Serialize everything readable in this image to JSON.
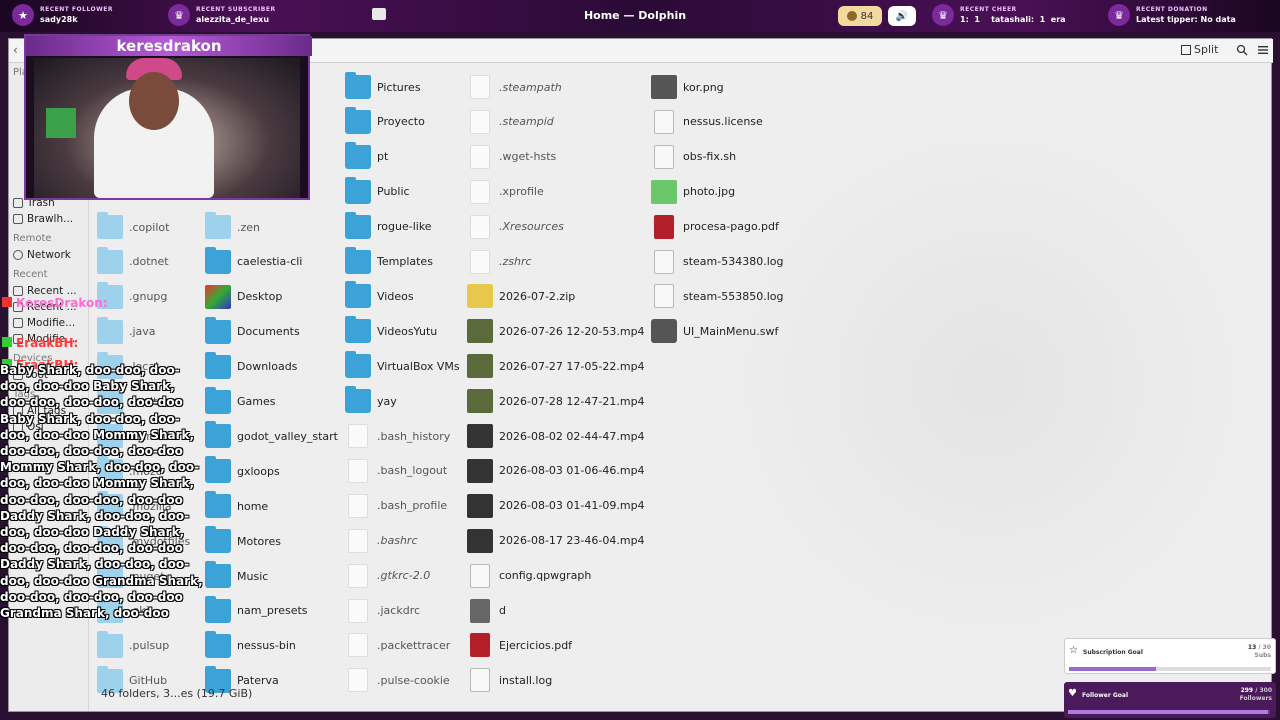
{
  "topbar": {
    "follower_label": "RECENT FOLLOWER",
    "follower_name": "sady28k",
    "subscriber_label": "RECENT SUBSCRIBER",
    "subscriber_name": "alezzita_de_lexu",
    "window_title": "Home — Dolphin",
    "points": "84",
    "cheer_label": "RECENT CHEER",
    "cheer_left": "1:",
    "cheer_one": "1",
    "cheer_name": "tatashali:",
    "cheer_two": "1",
    "cheer_extra": "era",
    "donation_label": "RECENT DONATION",
    "donation_text": "Latest tipper: No data"
  },
  "toolbar": {
    "split_label": "Split"
  },
  "sidebar": {
    "top_label": "Plac",
    "trash": "Trash",
    "brawl": "Brawlh...",
    "remote_section": "Remote",
    "network": "Network",
    "recent_section": "Recent",
    "recent_files": "Recent ...",
    "recent_locations": "Recent ...",
    "modified1": "Modifie...",
    "modified2": "Modifie...",
    "devices_section": "Devices",
    "root": "root",
    "tags_section": "Tags",
    "all_tags": "All tags",
    "osi": "Osi"
  },
  "columns": [
    [
      {
        "name": ".copilot",
        "type": "hfolder",
        "style": "hidden"
      },
      {
        "name": ".dotnet",
        "type": "hfolder",
        "style": "hidden"
      },
      {
        "name": ".gnupg",
        "type": "hfolder",
        "style": "hidden"
      },
      {
        "name": ".java",
        "type": "hfolder",
        "style": "hidden"
      },
      {
        "name": ".local",
        "type": "hfolder",
        "style": "hidden"
      },
      {
        "name": ".maltego",
        "type": "hfolder",
        "style": "hidden"
      },
      {
        "name": ".minecraft",
        "type": "hfolder",
        "style": "hidden"
      },
      {
        "name": ".mozc",
        "type": "hfolder",
        "style": "hidden"
      },
      {
        "name": ".mozilla",
        "type": "hfolder",
        "style": "hidden"
      },
      {
        "name": ".mydotfiles",
        "type": "hfolder",
        "style": "hidden"
      },
      {
        "name": ".nuget",
        "type": "hfolder",
        "style": "hidden"
      },
      {
        "name": ".oki",
        "type": "hfolder",
        "style": "hidden"
      },
      {
        "name": ".pulsup",
        "type": "hfolder",
        "style": "hidden"
      },
      {
        "name": "GitHub",
        "type": "hfolder",
        "style": "hidden"
      }
    ],
    [
      {
        "name": ".zen",
        "type": "hfolder",
        "style": "hidden"
      },
      {
        "name": "caelestia-cli",
        "type": "folder",
        "style": ""
      },
      {
        "name": "Desktop",
        "type": "mask",
        "style": ""
      },
      {
        "name": "Documents",
        "type": "folder",
        "style": ""
      },
      {
        "name": "Downloads",
        "type": "folder",
        "style": ""
      },
      {
        "name": "Games",
        "type": "folder",
        "style": ""
      },
      {
        "name": "godot_valley_start",
        "type": "folder",
        "style": ""
      },
      {
        "name": "gxloops",
        "type": "folder",
        "style": ""
      },
      {
        "name": "home",
        "type": "folder",
        "style": ""
      },
      {
        "name": "Motores",
        "type": "folder",
        "style": ""
      },
      {
        "name": "Music",
        "type": "folder",
        "style": ""
      },
      {
        "name": "nam_presets",
        "type": "folder",
        "style": ""
      },
      {
        "name": "nessus-bin",
        "type": "folder",
        "style": ""
      },
      {
        "name": "Paterva",
        "type": "folder",
        "style": ""
      }
    ],
    [
      {
        "name": "Pictures",
        "type": "folder",
        "style": ""
      },
      {
        "name": "Proyecto",
        "type": "folder",
        "style": ""
      },
      {
        "name": "pt",
        "type": "folder",
        "style": ""
      },
      {
        "name": "Public",
        "type": "folder",
        "style": ""
      },
      {
        "name": "rogue-like",
        "type": "folder",
        "style": ""
      },
      {
        "name": "Templates",
        "type": "folder",
        "style": ""
      },
      {
        "name": "Videos",
        "type": "folder",
        "style": ""
      },
      {
        "name": "VideosYutu",
        "type": "folder",
        "style": ""
      },
      {
        "name": "VirtualBox VMs",
        "type": "folder",
        "style": ""
      },
      {
        "name": "yay",
        "type": "folder",
        "style": ""
      },
      {
        "name": ".bash_history",
        "type": "hdoc",
        "style": "hidden"
      },
      {
        "name": ".bash_logout",
        "type": "hdoc",
        "style": "hidden"
      },
      {
        "name": ".bash_profile",
        "type": "hdoc",
        "style": "hidden"
      },
      {
        "name": ".bashrc",
        "type": "hdoc",
        "style": "italic"
      },
      {
        "name": ".gtkrc-2.0",
        "type": "hdoc",
        "style": "italic"
      },
      {
        "name": ".jackdrc",
        "type": "hdoc",
        "style": "hidden"
      },
      {
        "name": ".packettracer",
        "type": "hdoc",
        "style": "hidden"
      },
      {
        "name": ".pulse-cookie",
        "type": "hdoc",
        "style": "hidden"
      }
    ],
    [
      {
        "name": ".steampath",
        "type": "hdoc",
        "style": "italic"
      },
      {
        "name": ".steampid",
        "type": "hdoc",
        "style": "italic"
      },
      {
        "name": ".wget-hsts",
        "type": "hdoc",
        "style": "hidden"
      },
      {
        "name": ".xprofile",
        "type": "hdoc",
        "style": "hidden"
      },
      {
        "name": ".Xresources",
        "type": "hdoc",
        "style": "italic"
      },
      {
        "name": ".zshrc",
        "type": "hdoc",
        "style": "italic"
      },
      {
        "name": "2026-07-2.zip",
        "type": "zip",
        "style": ""
      },
      {
        "name": "2026-07-26 12-20-53.mp4",
        "type": "vid2",
        "style": ""
      },
      {
        "name": "2026-07-27 17-05-22.mp4",
        "type": "vid2",
        "style": ""
      },
      {
        "name": "2026-07-28 12-47-21.mp4",
        "type": "vid2",
        "style": ""
      },
      {
        "name": "2026-08-02 02-44-47.mp4",
        "type": "vid",
        "style": ""
      },
      {
        "name": "2026-08-03 01-06-46.mp4",
        "type": "vid",
        "style": ""
      },
      {
        "name": "2026-08-03 01-41-09.mp4",
        "type": "vid",
        "style": ""
      },
      {
        "name": "2026-08-17 23-46-04.mp4",
        "type": "vid",
        "style": ""
      },
      {
        "name": "config.qpwgraph",
        "type": "doc",
        "style": ""
      },
      {
        "name": "d",
        "type": "gray",
        "style": ""
      },
      {
        "name": "Ejercicios.pdf",
        "type": "pdf",
        "style": ""
      },
      {
        "name": "install.log",
        "type": "doc",
        "style": ""
      }
    ],
    [
      {
        "name": "kor.png",
        "type": "imgk",
        "style": ""
      },
      {
        "name": "nessus.license",
        "type": "doc",
        "style": ""
      },
      {
        "name": "obs-fix.sh",
        "type": "doc",
        "style": ""
      },
      {
        "name": "photo.jpg",
        "type": "img",
        "style": ""
      },
      {
        "name": "procesa-pago.pdf",
        "type": "pdf",
        "style": ""
      },
      {
        "name": "steam-534380.log",
        "type": "doc",
        "style": ""
      },
      {
        "name": "steam-553850.log",
        "type": "doc",
        "style": ""
      },
      {
        "name": "UI_MainMenu.swf",
        "type": "swf",
        "style": ""
      }
    ]
  ],
  "status_text": "46 folders, 3...es (19.7 GiB)",
  "stream": {
    "streamer_name": "keresdrakon",
    "chat_user1": "KeresDrakon:",
    "chat_user2": "EraakBH:",
    "chat_user3": "EraakBH:",
    "chat_message": "Baby Shark, doo-doo, doo-doo, doo-doo Baby Shark, doo-doo, doo-doo, doo-doo Baby Shark, doo-doo, doo-doo, doo-doo Mommy Shark, doo-doo, doo-doo, doo-doo Mommy Shark, doo-doo, doo-doo, doo-doo Mommy Shark, doo-doo, doo-doo, doo-doo Daddy Shark, doo-doo, doo-doo, doo-doo Daddy Shark, doo-doo, doo-doo, doo-doo Daddy Shark, doo-doo, doo-doo, doo-doo Grandma Shark, doo-doo, doo-doo, doo-doo Grandma Shark, doo-doo"
  },
  "goals": {
    "sub_label": "Subscription Goal",
    "sub_count": "13",
    "sub_total": "/ 30",
    "sub_unit": "Subs",
    "sub_progress": 0.43,
    "follow_label": "Follower Goal",
    "follow_count": "299",
    "follow_total": "/ 300",
    "follow_unit": "Followers",
    "follow_progress": 0.99
  },
  "colors": {
    "folder": "#3ba3d8",
    "accent_purple": "#b55ad5"
  }
}
